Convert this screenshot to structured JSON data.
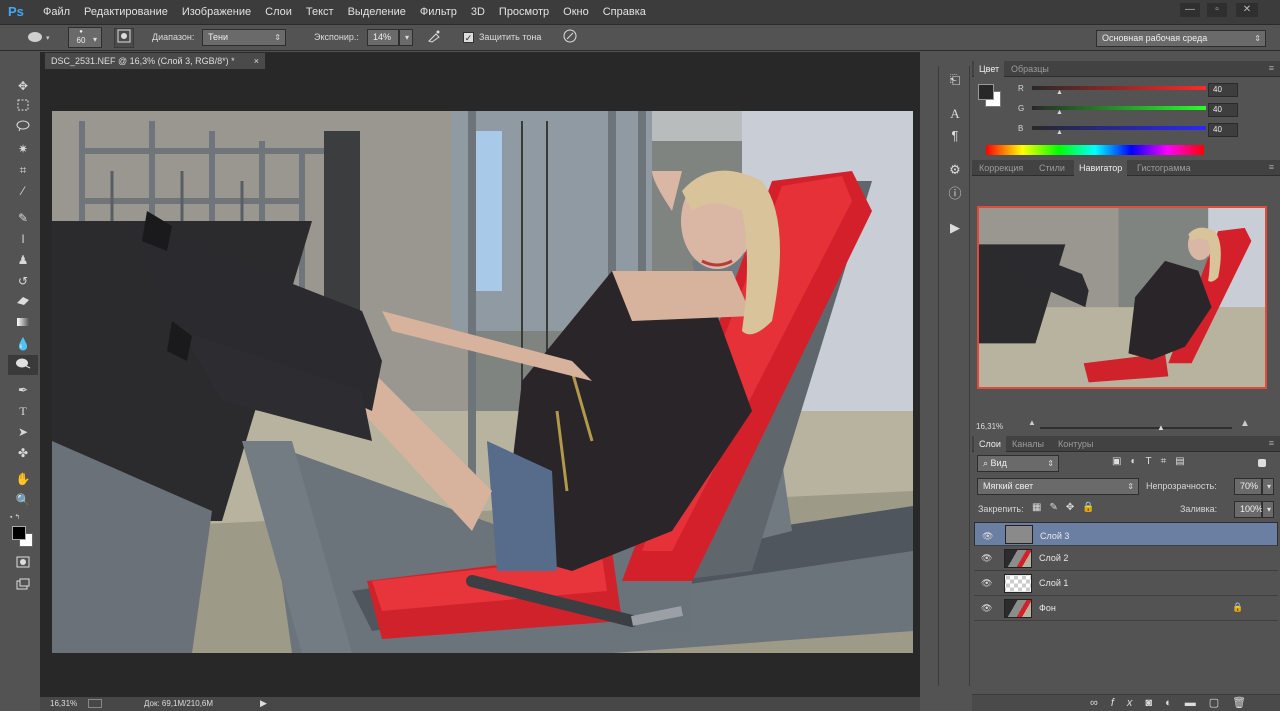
{
  "app": {
    "logo": "Ps"
  },
  "menu": [
    "Файл",
    "Редактирование",
    "Изображение",
    "Слои",
    "Текст",
    "Выделение",
    "Фильтр",
    "3D",
    "Просмотр",
    "Окно",
    "Справка"
  ],
  "window_controls": {
    "minimize": "—",
    "restore": "▫",
    "close": "✕"
  },
  "options": {
    "brush_size": "60",
    "range_label": "Диапазон:",
    "range_value": "Тени",
    "exposure_label": "Экспонир.:",
    "exposure_value": "14%",
    "protect_label": "Защитить тона",
    "protect_checked": true,
    "workspace": "Основная рабочая среда"
  },
  "document": {
    "tab_title": "DSC_2531.NEF @ 16,3% (Слой 3, RGB/8*) *",
    "zoom": "16,31%",
    "doc_info": "Док: 69,1M/210,6M"
  },
  "tools": [
    "move-tool",
    "marquee-tool",
    "lasso-tool",
    "magic-wand-tool",
    "crop-tool",
    "eyedropper-tool",
    "healing-brush-tool",
    "brush-tool",
    "clone-stamp-tool",
    "history-brush-tool",
    "eraser-tool",
    "gradient-tool",
    "blur-tool",
    "dodge-tool",
    "pen-tool",
    "type-tool",
    "path-selection-tool",
    "shape-tool",
    "hand-tool",
    "zoom-tool"
  ],
  "color_panel": {
    "tabs": [
      "Цвет",
      "Образцы"
    ],
    "active_tab": "Цвет",
    "r_label": "R",
    "g_label": "G",
    "b_label": "B",
    "r": "40",
    "g": "40",
    "b": "40",
    "foreground": "#282828",
    "background": "#ffffff"
  },
  "navigator_panel": {
    "tabs": [
      "Коррекция",
      "Стили",
      "Навигатор",
      "Гистограмма"
    ],
    "active_tab": "Навигатор",
    "zoom": "16,31%",
    "zoom_level": 0.63
  },
  "layers_panel": {
    "tabs": [
      "Слои",
      "Каналы",
      "Контуры"
    ],
    "active_tab": "Слои",
    "filter": "Вид",
    "blend_mode": "Мягкий свет",
    "opacity_label": "Непрозрачность:",
    "opacity": "70%",
    "lock_label": "Закрепить:",
    "fill_label": "Заливка:",
    "fill": "100%",
    "layers": [
      {
        "name": "Слой 3",
        "selected": true,
        "thumb": "gray",
        "locked": false
      },
      {
        "name": "Слой 2",
        "selected": false,
        "thumb": "photo",
        "locked": false
      },
      {
        "name": "Слой 1",
        "selected": false,
        "thumb": "transparent",
        "locked": false
      },
      {
        "name": "Фон",
        "selected": false,
        "thumb": "photo",
        "locked": true
      }
    ]
  },
  "colors": {
    "accent": "#3fa9f5",
    "selection": "#6b7fa3",
    "seat_red": "#d4202a"
  }
}
